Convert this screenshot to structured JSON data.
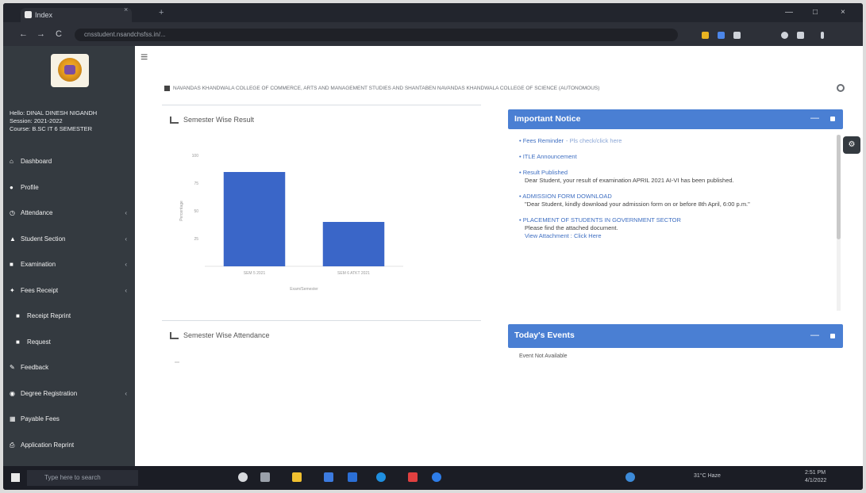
{
  "browser": {
    "tab_title": "Index",
    "tab_close": "×",
    "new_tab": "+",
    "url": "cnsstudent.nsandchsfss.in/...",
    "back": "←",
    "forward": "→",
    "reload": "C",
    "minimize": "—",
    "maximize": "□",
    "close": "×"
  },
  "sidebar": {
    "user_name": "Hello: DINAL DINESH NIGANDH",
    "session": "Session: 2021-2022",
    "course": "Course: B.SC IT 6 SEMESTER",
    "items": [
      {
        "icon": "home-icon",
        "glyph": "⌂",
        "label": "Dashboard",
        "has_sub": false
      },
      {
        "icon": "profile-icon",
        "glyph": "●",
        "label": "Profile",
        "has_sub": false
      },
      {
        "icon": "attendance-icon",
        "glyph": "◷",
        "label": "Attendance",
        "has_sub": true
      },
      {
        "icon": "student-section-icon",
        "glyph": "▲",
        "label": "Student Section",
        "has_sub": true
      },
      {
        "icon": "examination-icon",
        "glyph": "■",
        "label": "Examination",
        "has_sub": true
      },
      {
        "icon": "fees-icon",
        "glyph": "✦",
        "label": "Fees Receipt",
        "has_sub": true
      },
      {
        "icon": "receipt-icon",
        "glyph": "■",
        "label": "Receipt Reprint",
        "has_sub": false,
        "sub": true
      },
      {
        "icon": "request-icon",
        "glyph": "■",
        "label": "Request",
        "has_sub": false,
        "sub": true
      },
      {
        "icon": "feedback-icon",
        "glyph": "✎",
        "label": "Feedback",
        "has_sub": false
      },
      {
        "icon": "degree-icon",
        "glyph": "◉",
        "label": "Degree Registration",
        "has_sub": true
      },
      {
        "icon": "payable-icon",
        "glyph": "▦",
        "label": "Payable Fees",
        "has_sub": false
      },
      {
        "icon": "application-icon",
        "glyph": "⎙",
        "label": "Application Reprint",
        "has_sub": false
      }
    ],
    "chevron": "‹"
  },
  "header": {
    "hamburger": "≡",
    "college_name": "NAVANDAS KHANDWALA COLLEGE OF COMMERCE, ARTS AND MANAGEMENT STUDIES AND SHANTABEN NAVANDAS KHANDWALA COLLEGE OF SCIENCE (AUTONOMOUS)"
  },
  "result_card": {
    "title": "Semester Wise Result"
  },
  "attendance_card": {
    "title": "Semester Wise Attendance"
  },
  "chart_data": {
    "type": "bar",
    "title": "",
    "xlabel": "Exam/Semester",
    "ylabel": "Percentage",
    "categories": [
      "SEM 5 2021",
      "SEM 6 ATKT 2021"
    ],
    "values": [
      85,
      40
    ],
    "ylim": [
      0,
      100
    ],
    "yticks": [
      25,
      50,
      75,
      100
    ],
    "color": "#3a66c8"
  },
  "notices": {
    "title": "Important Notice",
    "collapse": "—",
    "items": [
      {
        "title": "Fees Reminder",
        "suffix": "- Pls check/click here",
        "desc": "",
        "link": ""
      },
      {
        "title": "ITLE Announcement",
        "suffix": "",
        "desc": "",
        "link": ""
      },
      {
        "title": "Result Published",
        "suffix": "",
        "desc": "Dear Student, your result of examination APRIL 2021 AI-VI has been published.",
        "link": ""
      },
      {
        "title": "ADMISSION FORM DOWNLOAD",
        "suffix": "",
        "desc": "\"Dear Student, kindly download your admission form on or before 8th April, 6:00 p.m.\"",
        "link": ""
      },
      {
        "title": "PLACEMENT OF STUDENTS IN GOVERNMENT SECTOR",
        "suffix": "",
        "desc": "Please find the attached document.",
        "link": "View Attachment : Click Here"
      }
    ]
  },
  "events": {
    "title": "Today's Events",
    "collapse": "—",
    "empty_text": "Event Not Available"
  },
  "settings_button": "⚙",
  "taskbar": {
    "search_placeholder": "Type here to search",
    "weather": "31°C Haze",
    "time": "2:51 PM",
    "date": "4/1/2022"
  },
  "colors": {
    "sidebar": "#343a40",
    "header_blue": "#4a7fd3",
    "bar": "#3a66c8"
  }
}
